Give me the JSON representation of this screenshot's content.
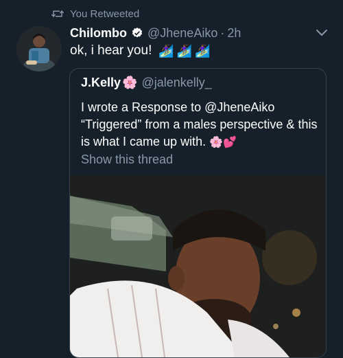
{
  "retweet": {
    "label": "You Retweeted",
    "icon": "retweet-icon"
  },
  "tweet": {
    "author_name": "Chilombo",
    "handle": "@JheneAiko",
    "separator": "·",
    "time": "2h",
    "text": "ok, i hear you!",
    "emoji": [
      "🏄🏾‍♀️",
      "🏄🏾‍♀️",
      "🏄🏾‍♀️"
    ]
  },
  "quote": {
    "author_name": "J.Kelly",
    "author_emoji": "🌸",
    "handle": "@jalenkelly_",
    "text": "I wrote a Response to @JheneAiko “Triggered” from a males perspective & this is what I came up with.",
    "text_emoji": "🌸💕",
    "show_thread": "Show this thread"
  },
  "colors": {
    "background": "#15202b",
    "secondary_text": "#8899a6",
    "border": "#38444d",
    "verified": "#ffffff"
  }
}
